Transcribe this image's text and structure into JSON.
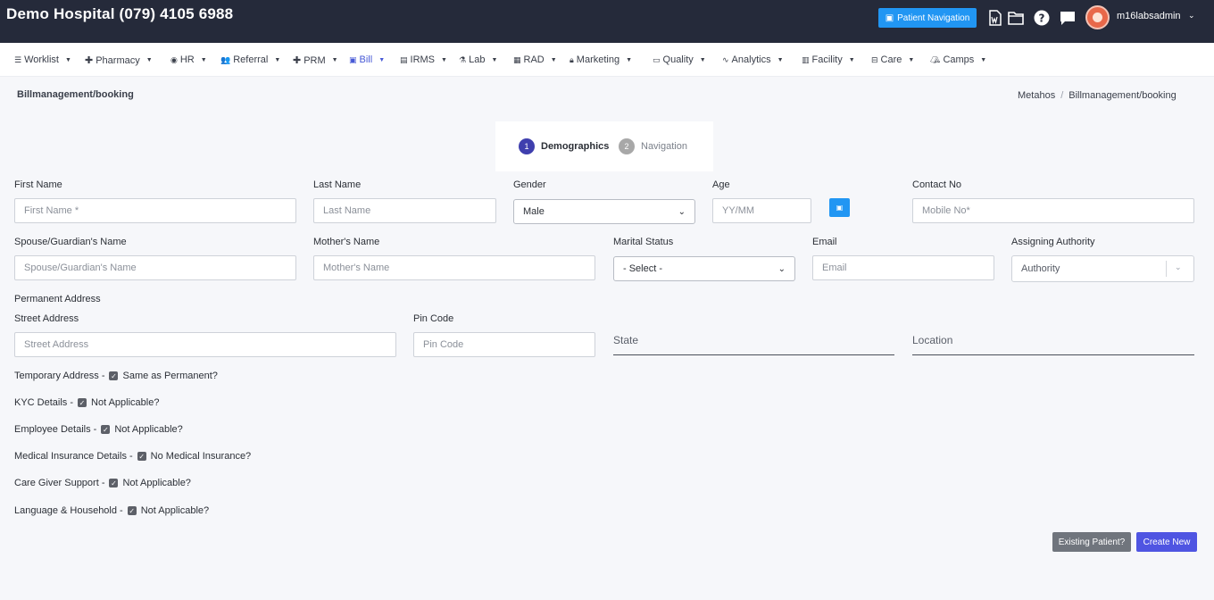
{
  "header": {
    "hospital_title": "Demo Hospital (079) 4105 6988",
    "patient_nav_label": "Patient Navigation",
    "username": "m16labsadmin"
  },
  "menu": [
    {
      "label": "Worklist",
      "icon": "list-icon"
    },
    {
      "label": "Pharmacy",
      "icon": "plus-icon"
    },
    {
      "label": "HR",
      "icon": "user-circle-icon"
    },
    {
      "label": "Referral",
      "icon": "users-icon"
    },
    {
      "label": "PRM",
      "icon": "plus-icon"
    },
    {
      "label": "Bill",
      "icon": "bill-icon"
    },
    {
      "label": "IRMS",
      "icon": "card-icon"
    },
    {
      "label": "Lab",
      "icon": "flask-icon"
    },
    {
      "label": "RAD",
      "icon": "film-icon"
    },
    {
      "label": "Marketing",
      "icon": "bag-icon"
    },
    {
      "label": "Quality",
      "icon": "badge-icon"
    },
    {
      "label": "Analytics",
      "icon": "pulse-icon"
    },
    {
      "label": "Facility",
      "icon": "building-icon"
    },
    {
      "label": "Care",
      "icon": "bed-icon"
    },
    {
      "label": "Camps",
      "icon": "tent-icon"
    }
  ],
  "page": {
    "title": "Billmanagement/booking",
    "breadcrumb": [
      "Metahos",
      "Billmanagement/booking"
    ]
  },
  "stepper": {
    "step1_num": "1",
    "step1_label": "Demographics",
    "step2_num": "2",
    "step2_label": "Navigation"
  },
  "form": {
    "first_name_label": "First Name",
    "first_name_ph": "First Name *",
    "last_name_label": "Last Name",
    "last_name_ph": "Last Name",
    "gender_label": "Gender",
    "gender_value": "Male",
    "age_label": "Age",
    "age_ph": "YY/MM",
    "contact_label": "Contact No",
    "contact_ph": "Mobile No*",
    "spouse_label": "Spouse/Guardian's Name",
    "spouse_ph": "Spouse/Guardian's Name",
    "mother_label": "Mother's Name",
    "mother_ph": "Mother's Name",
    "marital_label": "Marital Status",
    "marital_value": "- Select -",
    "email_label": "Email",
    "email_ph": "Email",
    "authority_label": "Assigning Authority",
    "authority_ph": "Authority",
    "perm_address_label": "Permanent Address",
    "street_label": "Street Address",
    "street_ph": "Street Address",
    "pin_label": "Pin Code",
    "pin_ph": "Pin Code",
    "state_ph": "State",
    "location_ph": "Location"
  },
  "checks": [
    {
      "section": "Temporary Address -",
      "option": "Same as Permanent?"
    },
    {
      "section": "KYC Details -",
      "option": "Not Applicable?"
    },
    {
      "section": "Employee Details -",
      "option": "Not Applicable?"
    },
    {
      "section": "Medical Insurance Details -",
      "option": "No Medical Insurance?"
    },
    {
      "section": "Care Giver Support -",
      "option": "Not Applicable?"
    },
    {
      "section": "Language & Household -",
      "option": "Not Applicable?"
    }
  ],
  "actions": {
    "existing_label": "Existing Patient?",
    "create_label": "Create New"
  },
  "colors": {
    "topbar": "#252a3a",
    "accent": "#4759d6",
    "info": "#2196f3",
    "primary_button": "#4f55e2"
  }
}
